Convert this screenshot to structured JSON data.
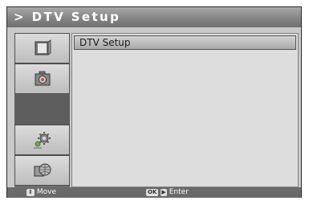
{
  "header": {
    "title": "> DTV Setup"
  },
  "sidebar": {
    "items": [
      {
        "icon": "tv-icon"
      },
      {
        "icon": "camera-icon"
      },
      {
        "icon": "empty-slot"
      },
      {
        "icon": "gear-setup-icon"
      },
      {
        "icon": "globe-network-icon"
      }
    ]
  },
  "menu": {
    "items": [
      {
        "label": "DTV Setup"
      }
    ]
  },
  "footer": {
    "move": {
      "keys": "⇕",
      "label": "Move"
    },
    "enter": {
      "key_ok": "OK",
      "key_arrow": "▶",
      "label": "Enter"
    }
  }
}
